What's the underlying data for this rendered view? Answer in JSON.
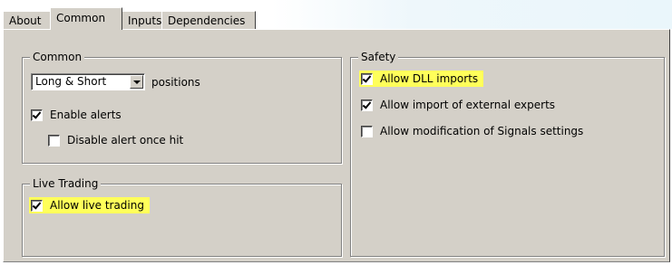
{
  "tabs": [
    {
      "label": "About"
    },
    {
      "label": "Common"
    },
    {
      "label": "Inputs"
    },
    {
      "label": "Dependencies"
    }
  ],
  "active_tab": "Common",
  "common": {
    "title": "Common",
    "direction_select": {
      "value": "Long & Short",
      "suffix": "positions"
    },
    "enable_alerts": {
      "label": "Enable alerts",
      "checked": true
    },
    "disable_alert_once_hit": {
      "label": "Disable alert once hit",
      "checked": false
    }
  },
  "live_trading": {
    "title": "Live Trading",
    "allow_live_trading": {
      "label": "Allow live trading",
      "checked": true,
      "highlighted": true
    }
  },
  "safety": {
    "title": "Safety",
    "allow_dll_imports": {
      "label": "Allow DLL imports",
      "checked": true,
      "highlighted": true
    },
    "allow_external_experts": {
      "label": "Allow import of external experts",
      "checked": true
    },
    "allow_signals_modification": {
      "label": "Allow modification of Signals settings",
      "checked": false
    }
  },
  "colors": {
    "panel": "#d4d0c8",
    "highlight": "#ffff5a"
  }
}
